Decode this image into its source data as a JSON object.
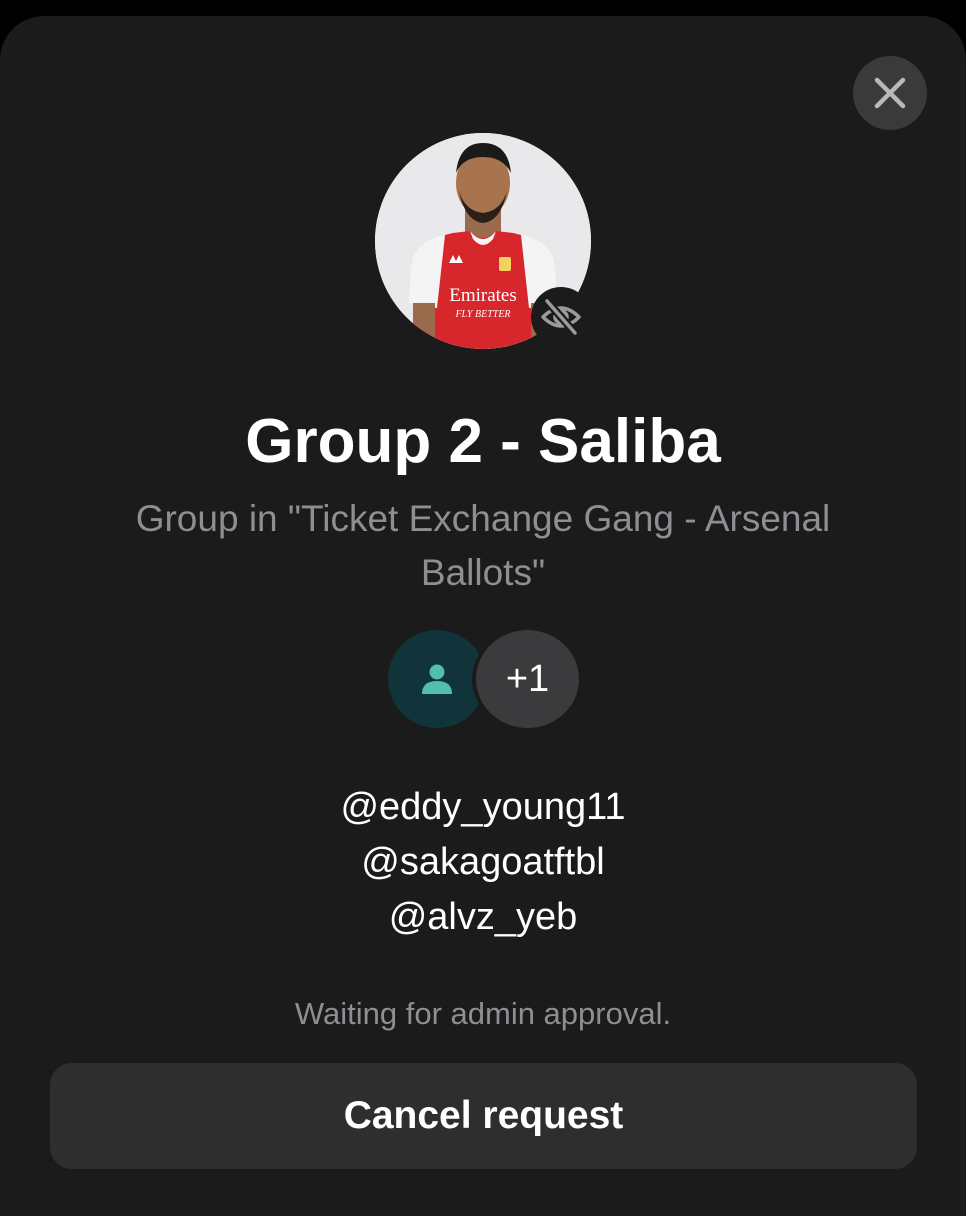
{
  "icons": {
    "close": "close-icon",
    "visibility": "eye-off-icon",
    "member": "person-icon"
  },
  "colors": {
    "background": "#1b1b1b",
    "accent": "#53bdae",
    "secondary_text": "#8e8e93",
    "button": "#2e2e2e"
  },
  "group": {
    "name": "Group 2 - Saliba",
    "subtitle": "Group in \"Ticket Exchange Gang - Arsenal Ballots\"",
    "more_members": "+1",
    "avatar_shirt_sponsor": "Emirates",
    "avatar_shirt_tagline": "FLY BETTER"
  },
  "members": [
    "@eddy_young11",
    "@sakagoatftbl",
    "@alvz_yeb"
  ],
  "status": "Waiting for admin approval.",
  "actions": {
    "cancel_label": "Cancel request"
  }
}
